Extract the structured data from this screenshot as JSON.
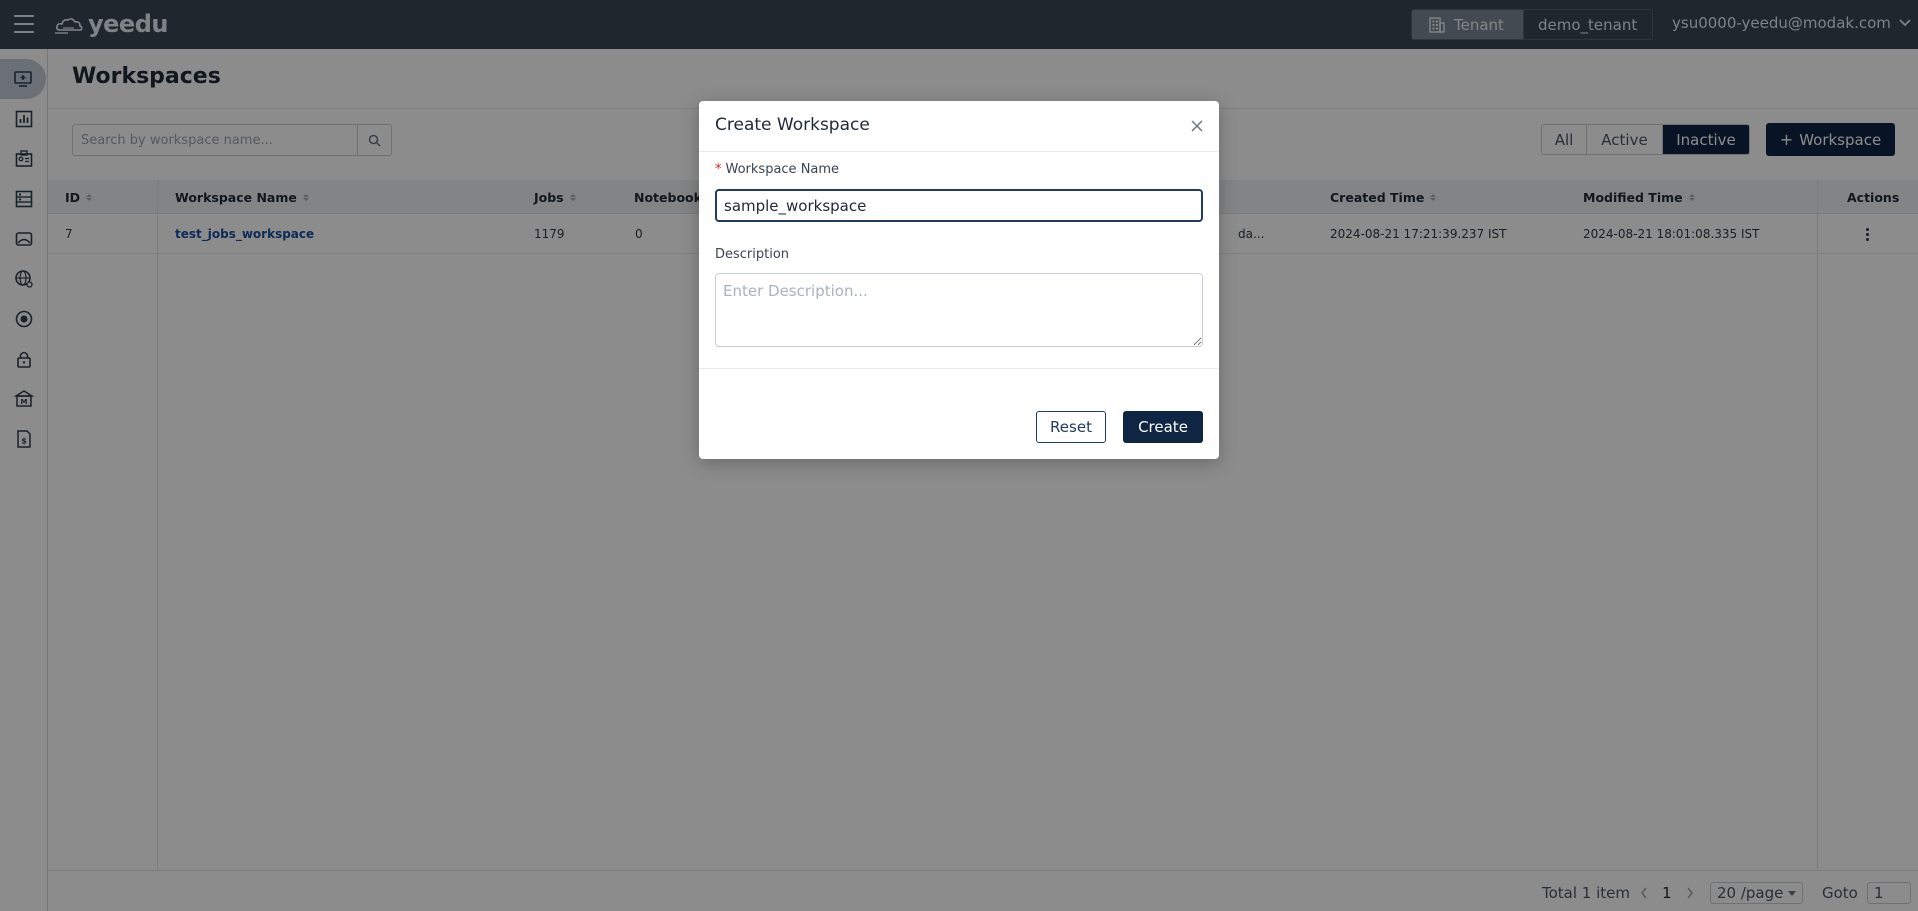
{
  "topbar": {
    "logo_text": "yeedu",
    "tenant_label": "Tenant",
    "tenant_value": "demo_tenant",
    "user_email": "ysu0000-yeedu@modak.com"
  },
  "sidebar": {
    "items": [
      {
        "icon": "workspace-icon",
        "active": true
      },
      {
        "icon": "chart-icon"
      },
      {
        "icon": "user-badge-icon"
      },
      {
        "icon": "cluster-icon"
      },
      {
        "icon": "image-icon"
      },
      {
        "icon": "globe-icon"
      },
      {
        "icon": "target-icon"
      },
      {
        "icon": "lock-icon"
      },
      {
        "icon": "bank-icon"
      },
      {
        "icon": "billing-icon"
      }
    ]
  },
  "page": {
    "title": "Workspaces",
    "search_placeholder": "Search by workspace name...",
    "filters": [
      "All",
      "Active",
      "Inactive"
    ],
    "selected_filter": "Inactive",
    "add_button": "Workspace"
  },
  "table": {
    "columns": [
      "ID",
      "Workspace Name",
      "Jobs",
      "Notebooks",
      "Created Time",
      "Modified Time",
      "Actions"
    ],
    "rows": [
      {
        "id": "7",
        "name": "test_jobs_workspace",
        "jobs": "1179",
        "notebooks": "0",
        "hidden_partial": "da...",
        "created": "2024-08-21 17:21:39.237 IST",
        "modified": "2024-08-21 18:01:08.335 IST"
      }
    ]
  },
  "pagination": {
    "total": "Total 1 item",
    "page": "1",
    "page_size": "20 /page",
    "goto_label": "Goto",
    "goto_value": "1"
  },
  "modal": {
    "title": "Create Workspace",
    "name_label": "Workspace Name",
    "name_value": "sample_workspace",
    "description_label": "Description",
    "description_placeholder": "Enter Description...",
    "reset_label": "Reset",
    "create_label": "Create"
  },
  "colors": {
    "topbar": "#3a4554",
    "primary": "#0f2544",
    "link": "#1d4e9e",
    "required": "#e02424"
  }
}
